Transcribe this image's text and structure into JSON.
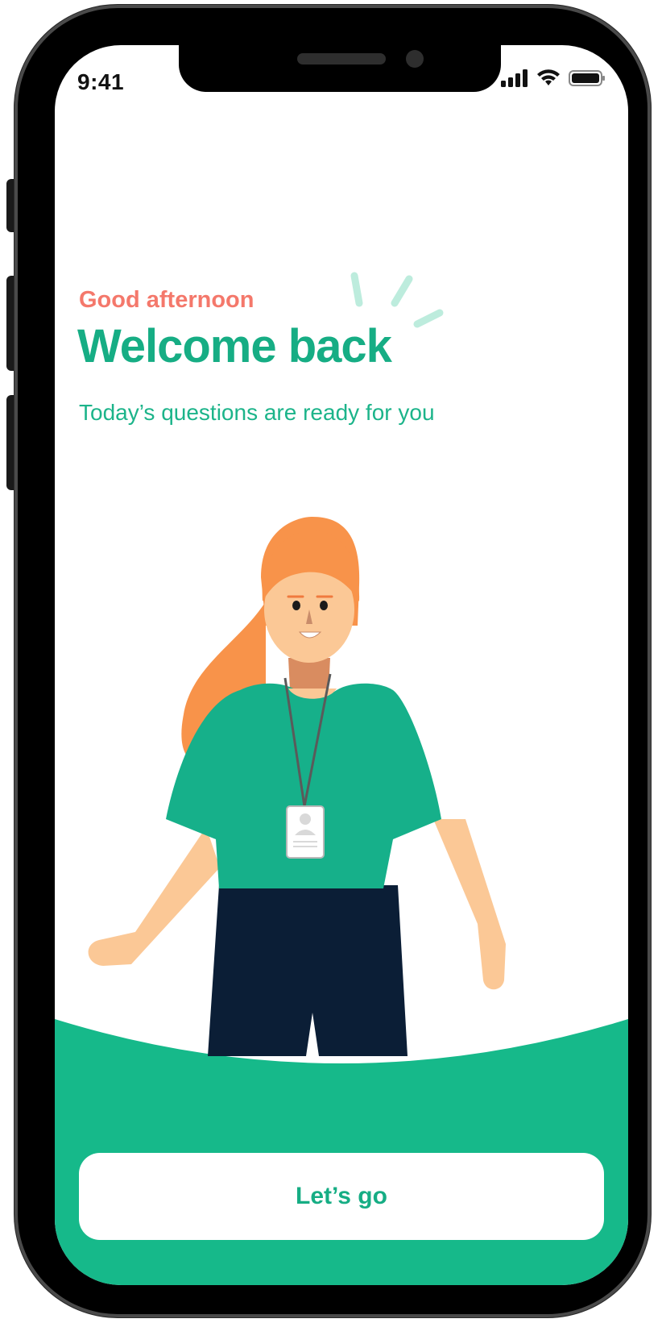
{
  "status_bar": {
    "time": "9:41",
    "icons": [
      "signal-icon",
      "wifi-icon",
      "battery-icon"
    ]
  },
  "welcome": {
    "greeting": "Good afternoon",
    "title": "Welcome back",
    "subtitle": "Today’s questions are ready for you"
  },
  "cta": {
    "label": "Let’s go"
  },
  "colors": {
    "accent": "#16ad84",
    "greeting": "#f4786b",
    "hair": "#f8934a",
    "skin": "#fbc896",
    "pants": "#0b1e36"
  }
}
